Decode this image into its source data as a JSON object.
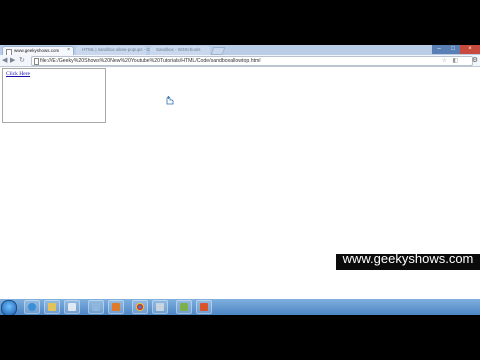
{
  "browser": {
    "tabs": [
      {
        "title": "www.geekyshows.com",
        "active": true
      },
      {
        "title": "HTML | sandbox allow-popups - Google",
        "active": false
      },
      {
        "title": "Sandbox - W3Schools",
        "active": false
      }
    ],
    "url": "file:///E:/Geeky%20Shows%20New%20Youtube%20Tutorials/HTML/Code/sandboxallowtop.html"
  },
  "page": {
    "link_text": "Click Here"
  },
  "watermark": "www.geekyshows.com",
  "colors": {
    "accent": "#4d86c4",
    "link": "#1a0dab",
    "close": "#c74a3c"
  }
}
